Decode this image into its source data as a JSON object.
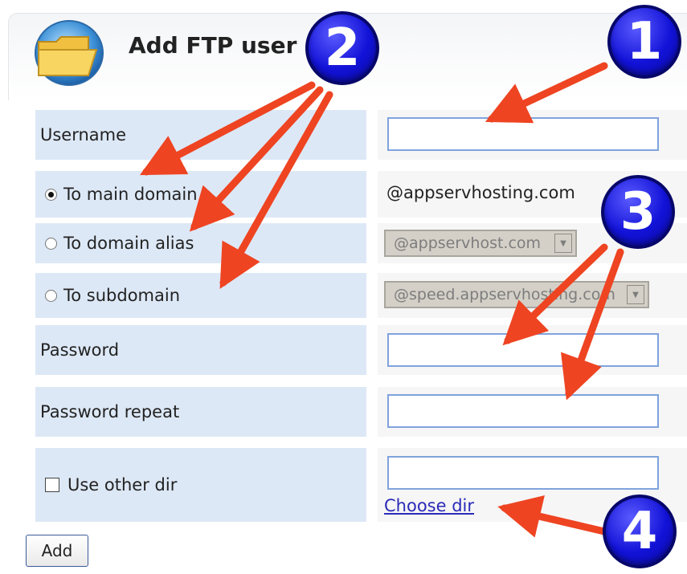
{
  "header": {
    "title": "Add FTP user"
  },
  "form": {
    "username_label": "Username",
    "main_domain_label": "To main domain",
    "main_domain_value": "@appservhosting.com",
    "alias_label": "To domain alias",
    "alias_select_value": "@appservhost.com",
    "subdomain_label": "To subdomain",
    "subdomain_select_value": "@speed.appservhosting.com",
    "password_label": "Password",
    "password_repeat_label": "Password repeat",
    "use_other_dir_label": "Use other dir",
    "choose_dir_link": "Choose dir",
    "add_button": "Add",
    "selected_target": "main domain"
  },
  "callouts": [
    "1",
    "2",
    "3",
    "4"
  ],
  "colors": {
    "label_bg": "#dde8f6",
    "badge": "#1212d8",
    "arrow": "#ee4422",
    "link": "#2a2ab8"
  }
}
